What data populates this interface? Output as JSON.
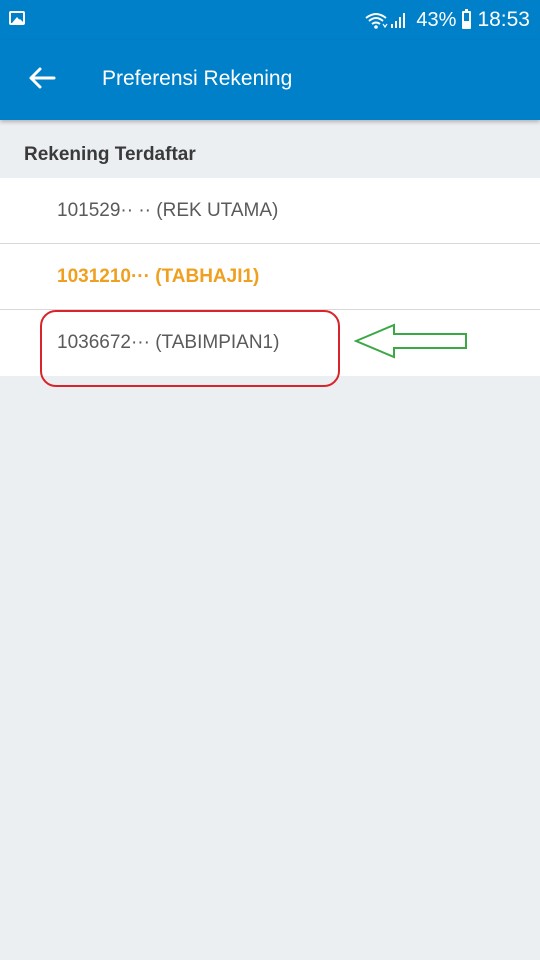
{
  "status_bar": {
    "battery_percent": "43%",
    "battery_level": 0.43,
    "time": "18:53",
    "icons": [
      "image-icon",
      "wifi-icon",
      "signal-icon",
      "battery-icon"
    ]
  },
  "app_bar": {
    "title": "Preferensi Rekening",
    "back_icon": "arrow-left-icon"
  },
  "section": {
    "title": "Rekening Terdaftar"
  },
  "accounts": [
    {
      "label": "101529·· ·· (REK UTAMA)",
      "selected": false
    },
    {
      "label": "1031210··· (TABHAJI1)",
      "selected": true
    },
    {
      "label": "1036672··· (TABIMPIAN1)",
      "selected": false
    }
  ],
  "annotations": {
    "highlight_color": "#d9242b",
    "arrow_color": "#3aa845"
  },
  "colors": {
    "primary": "#0080c8",
    "selected_text": "#f0a020",
    "background": "#eceff2"
  }
}
